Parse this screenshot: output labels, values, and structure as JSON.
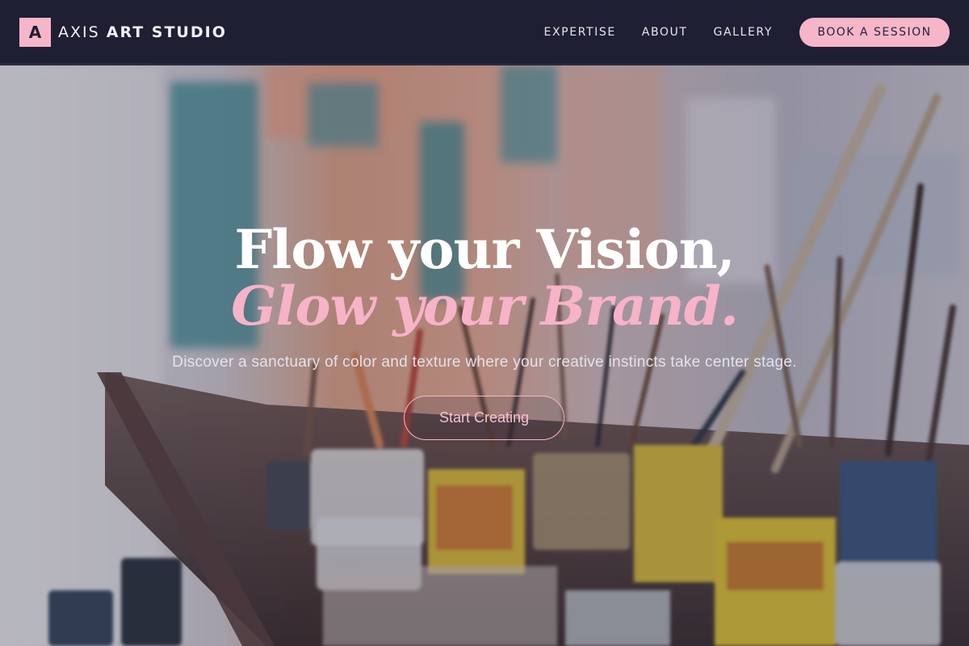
{
  "header": {
    "logo_mark": "A",
    "logo_light": "AXIS",
    "logo_bold": "ART STUDIO",
    "nav": [
      "EXPERTISE",
      "ABOUT",
      "GALLERY"
    ],
    "cta_label": "BOOK A SESSION"
  },
  "hero": {
    "headline_line1": "Flow your Vision,",
    "headline_line2": "Glow your Brand.",
    "subtext": "Discover a sanctuary of color and texture where your creative instincts take center stage.",
    "cta_label": "Start Creating",
    "background_image": "art studio table with paint brushes in cans and jars"
  },
  "colors": {
    "navbar_bg": "#1f1f33",
    "accent_pink": "#f7b6c8",
    "headline_white": "#ffffff",
    "headline_pink": "#f7b3c8"
  }
}
